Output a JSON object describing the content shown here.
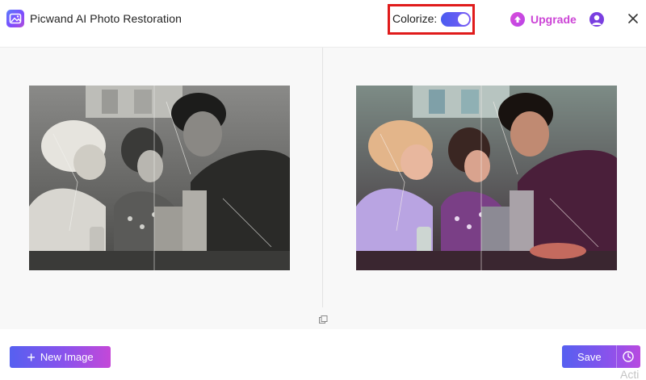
{
  "header": {
    "app_title": "Picwand AI Photo Restoration",
    "colorize_label": "Colorize:",
    "colorize_enabled": true,
    "upgrade_label": "Upgrade"
  },
  "footer": {
    "new_image_label": "New Image",
    "save_label": "Save",
    "watermark_text": "Acti"
  },
  "colors": {
    "accent": "#6a5cf0",
    "upgrade": "#cc44d6",
    "highlight_border": "#e01b1b"
  },
  "icons": {
    "logo": "picwand-logo-icon",
    "upgrade": "arrow-up-circle-icon",
    "user": "user-avatar-icon",
    "close": "close-icon",
    "compare": "compare-icon",
    "new_image": "plus-icon",
    "save_history": "clock-icon"
  }
}
